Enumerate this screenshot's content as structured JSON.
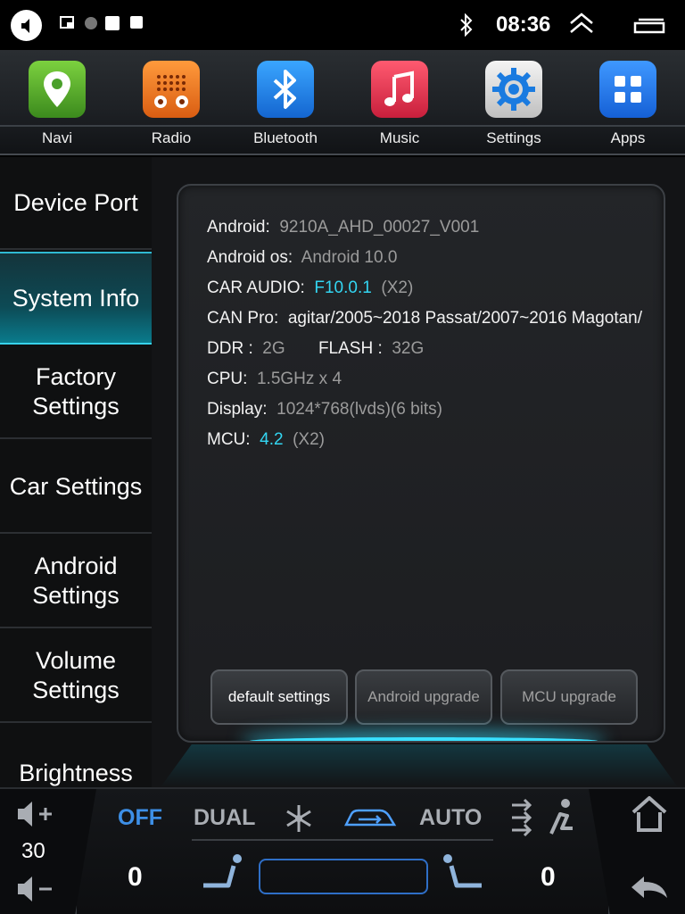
{
  "status_bar": {
    "time": "08:36",
    "icons": [
      "back-icon",
      "cast-icon",
      "dot-icon",
      "square-icon",
      "square-small-icon",
      "bluetooth-icon",
      "chevron-up-double-icon",
      "window-icon"
    ]
  },
  "apps": [
    {
      "label": "Navi",
      "icon": "map-pin-icon",
      "color": "#58b12c"
    },
    {
      "label": "Radio",
      "icon": "radio-icon",
      "color": "#f07a25"
    },
    {
      "label": "Bluetooth",
      "icon": "bluetooth-icon",
      "color": "#1f8bf0"
    },
    {
      "label": "Music",
      "icon": "music-note-icon",
      "color": "#e8344f"
    },
    {
      "label": "Settings",
      "icon": "gear-icon",
      "color": "#d8d8d8"
    },
    {
      "label": "Apps",
      "icon": "grid-icon",
      "color": "#2a83f2"
    }
  ],
  "menu": {
    "items": [
      {
        "label": "Device Port"
      },
      {
        "label": "System Info",
        "active": true
      },
      {
        "label": "Factory Settings"
      },
      {
        "label": "Car Settings"
      },
      {
        "label": "Android Settings"
      },
      {
        "label": "Volume Settings"
      },
      {
        "label": "Brightness"
      }
    ]
  },
  "system_info": {
    "android_key": "Android:",
    "android_val": "9210A_AHD_00027_V001",
    "android_os_key": "Android os:",
    "android_os_val": "Android 10.0",
    "car_audio_key": "CAR AUDIO:",
    "car_audio_val": "F10.0.1",
    "car_audio_extra": "(X2)",
    "can_pro_key": "CAN Pro:",
    "can_pro_val": "agitar/2005~2018 Passat/2007~2016 Magotan/",
    "ddr_key": "DDR :",
    "ddr_val": "2G",
    "flash_key": "FLASH :",
    "flash_val": "32G",
    "cpu_key": "CPU:",
    "cpu_val": "1.5GHz x 4",
    "display_key": "Display:",
    "display_val": "1024*768(lvds)(6 bits)",
    "mcu_key": "MCU:",
    "mcu_val": "4.2",
    "mcu_extra": "(X2)"
  },
  "buttons": {
    "default_settings": "default settings",
    "android_upgrade": "Android upgrade",
    "mcu_upgrade": "MCU upgrade"
  },
  "climate": {
    "volume": "30",
    "off": "OFF",
    "dual": "DUAL",
    "auto": "AUTO",
    "left_seat_level": "0",
    "right_seat_level": "0",
    "colors": {
      "off": "#3d8fe6",
      "labels": "#a9adb3",
      "accent": "#4ea0ff"
    }
  }
}
